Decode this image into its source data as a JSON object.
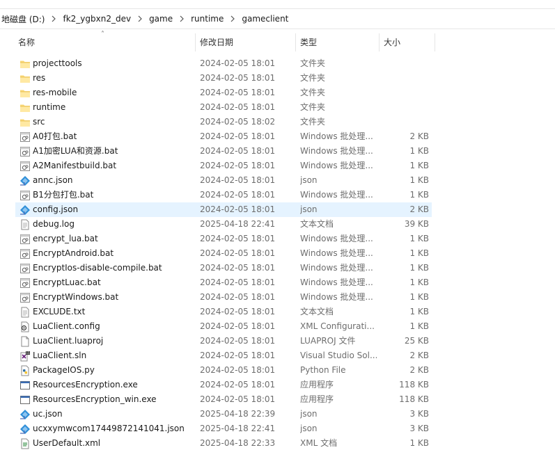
{
  "breadcrumb": [
    "地磁盘 (D:)",
    "fk2_ygbxn2_dev",
    "game",
    "runtime",
    "gameclient"
  ],
  "columns": {
    "name": "名称",
    "date": "修改日期",
    "type": "类型",
    "size": "大小"
  },
  "selected_index": 10,
  "files": [
    {
      "name": "projecttools",
      "date": "2024-02-05 18:01",
      "type": "文件夹",
      "size": "",
      "icon": "folder-icon"
    },
    {
      "name": "res",
      "date": "2024-02-05 18:01",
      "type": "文件夹",
      "size": "",
      "icon": "folder-icon"
    },
    {
      "name": "res-mobile",
      "date": "2024-02-05 18:01",
      "type": "文件夹",
      "size": "",
      "icon": "folder-icon"
    },
    {
      "name": "runtime",
      "date": "2024-02-05 18:01",
      "type": "文件夹",
      "size": "",
      "icon": "folder-icon"
    },
    {
      "name": "src",
      "date": "2024-02-05 18:02",
      "type": "文件夹",
      "size": "",
      "icon": "folder-icon"
    },
    {
      "name": "A0打包.bat",
      "date": "2024-02-05 18:01",
      "type": "Windows 批处理...",
      "size": "2 KB",
      "icon": "batch-file-icon"
    },
    {
      "name": "A1加密LUA和资源.bat",
      "date": "2024-02-05 18:01",
      "type": "Windows 批处理...",
      "size": "1 KB",
      "icon": "batch-file-icon"
    },
    {
      "name": "A2Manifestbuild.bat",
      "date": "2024-02-05 18:01",
      "type": "Windows 批处理...",
      "size": "1 KB",
      "icon": "batch-file-icon"
    },
    {
      "name": "annc.json",
      "date": "2024-02-05 18:01",
      "type": "json",
      "size": "1 KB",
      "icon": "json-file-icon"
    },
    {
      "name": "B1分包打包.bat",
      "date": "2024-02-05 18:01",
      "type": "Windows 批处理...",
      "size": "1 KB",
      "icon": "batch-file-icon"
    },
    {
      "name": "config.json",
      "date": "2024-02-05 18:01",
      "type": "json",
      "size": "2 KB",
      "icon": "json-file-icon"
    },
    {
      "name": "debug.log",
      "date": "2025-04-18 22:41",
      "type": "文本文档",
      "size": "39 KB",
      "icon": "text-file-icon"
    },
    {
      "name": "encrypt_lua.bat",
      "date": "2024-02-05 18:01",
      "type": "Windows 批处理...",
      "size": "1 KB",
      "icon": "batch-file-icon"
    },
    {
      "name": "EncryptAndroid.bat",
      "date": "2024-02-05 18:01",
      "type": "Windows 批处理...",
      "size": "1 KB",
      "icon": "batch-file-icon"
    },
    {
      "name": "EncryptIos-disable-compile.bat",
      "date": "2024-02-05 18:01",
      "type": "Windows 批处理...",
      "size": "1 KB",
      "icon": "batch-file-icon"
    },
    {
      "name": "EncryptLuac.bat",
      "date": "2024-02-05 18:01",
      "type": "Windows 批处理...",
      "size": "1 KB",
      "icon": "batch-file-icon"
    },
    {
      "name": "EncryptWindows.bat",
      "date": "2024-02-05 18:01",
      "type": "Windows 批处理...",
      "size": "1 KB",
      "icon": "batch-file-icon"
    },
    {
      "name": "EXCLUDE.txt",
      "date": "2024-02-05 18:01",
      "type": "文本文档",
      "size": "1 KB",
      "icon": "text-file-icon"
    },
    {
      "name": "LuaClient.config",
      "date": "2024-02-05 18:01",
      "type": "XML Configurati...",
      "size": "1 KB",
      "icon": "config-file-icon"
    },
    {
      "name": "LuaClient.luaproj",
      "date": "2024-02-05 18:01",
      "type": "LUAPROJ 文件",
      "size": "25 KB",
      "icon": "generic-file-icon"
    },
    {
      "name": "LuaClient.sln",
      "date": "2024-02-05 18:01",
      "type": "Visual Studio Sol...",
      "size": "2 KB",
      "icon": "visual-studio-solution-icon"
    },
    {
      "name": "PackageIOS.py",
      "date": "2024-02-05 18:01",
      "type": "Python File",
      "size": "2 KB",
      "icon": "python-file-icon"
    },
    {
      "name": "ResourcesEncryption.exe",
      "date": "2024-02-05 18:01",
      "type": "应用程序",
      "size": "118 KB",
      "icon": "executable-icon"
    },
    {
      "name": "ResourcesEncryption_win.exe",
      "date": "2024-02-05 18:01",
      "type": "应用程序",
      "size": "118 KB",
      "icon": "executable-icon"
    },
    {
      "name": "uc.json",
      "date": "2025-04-18 22:39",
      "type": "json",
      "size": "3 KB",
      "icon": "json-file-icon"
    },
    {
      "name": "ucxxymwcom17449872141041.json",
      "date": "2025-04-18 22:41",
      "type": "json",
      "size": "3 KB",
      "icon": "json-file-icon"
    },
    {
      "name": "UserDefault.xml",
      "date": "2025-04-18 22:33",
      "type": "XML 文档",
      "size": "1 KB",
      "icon": "xml-file-icon"
    }
  ]
}
